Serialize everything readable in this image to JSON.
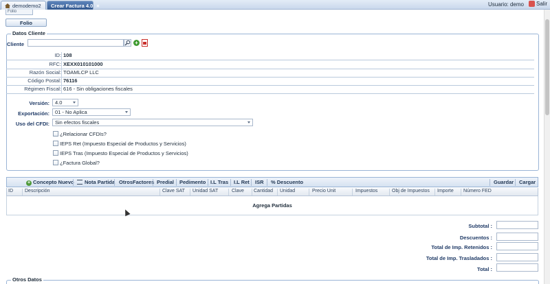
{
  "tabs": [
    {
      "label": "demodemo2"
    },
    {
      "label": "Crear Factura 4.0"
    }
  ],
  "user_label": "Usuario: demo",
  "logout_label": "Salir",
  "folio_header": "Folio",
  "folio_button": "Folio",
  "datos_cliente": {
    "legend": "Datos Cliente",
    "cliente_label": "Cliente",
    "cliente_value": "",
    "rows": [
      {
        "key": "ID:",
        "value": "108"
      },
      {
        "key": "RFC:",
        "value": "XEXX010101000"
      },
      {
        "key": "Razón Social:",
        "value": "TOAMLCP LLC"
      },
      {
        "key": "Código Postal:",
        "value": "76116"
      },
      {
        "key": "Régimen Fiscal:",
        "value": "616 - Sin obligaciones fiscales"
      }
    ]
  },
  "form": {
    "version_label": "Versión:",
    "version_value": "4.0",
    "exportacion_label": "Exportación:",
    "exportacion_value": "01 - No Aplica",
    "uso_cfdi_label": "Uso del CFDI:",
    "uso_cfdi_value": "Sin efectos fiscales"
  },
  "checkboxes": [
    "¿Relacionar CFDIs?",
    "IEPS Ret (Impuesto Especial de Productos y Servicios)",
    "IEPS Tras (Impuesto Especial de Productos y Servicios)",
    "¿Factura Global?"
  ],
  "toolbar": {
    "concepto_nuevo": "Concepto Nuevo",
    "nota_partida": "Nota Partida",
    "otros_factores": "OtrosFactores",
    "predial": "Predial",
    "pedimento": "Pedimento",
    "il_tras": "I.L Tras",
    "il_ret": "I.L Ret",
    "isr": "ISR",
    "pct_descuento": "% Descuento",
    "guardar": "Guardar",
    "cargar": "Cargar"
  },
  "grid": {
    "columns": [
      "ID",
      "Descripción",
      "Clave SAT",
      "Unidad SAT",
      "Clave",
      "Cantidad",
      "Unidad",
      "Precio Unit",
      "Impuestos",
      "Obj de Impuestos",
      "Importe",
      "Número FED"
    ],
    "empty_text": "Agrega Partidas"
  },
  "totals": [
    {
      "label": "Subtotal :"
    },
    {
      "label": "Descuentos :"
    },
    {
      "label": "Total de Imp. Retenidos :"
    },
    {
      "label": "Total de Imp. Trasladados :"
    },
    {
      "label": "Total :"
    }
  ],
  "otros_datos_legend": "Otros Datos"
}
